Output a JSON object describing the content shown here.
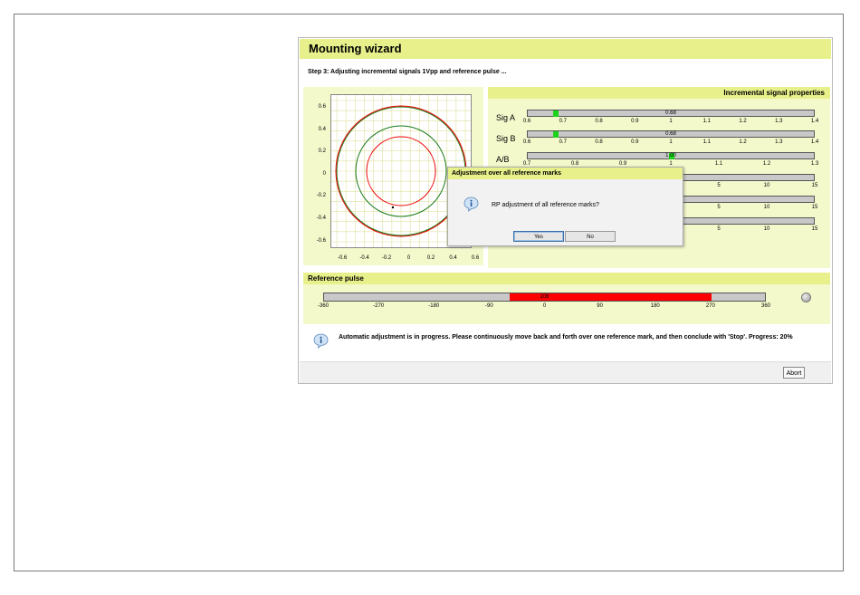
{
  "wizard": {
    "title": "Mounting wizard",
    "step": "Step 3: Adjusting incremental signals 1Vpp and reference pulse ...",
    "abort_label": "Abort",
    "message": "Automatic adjustment is in progress. Please continuously move back and forth over one reference mark, and then conclude with 'Stop'. Progress: 20%"
  },
  "plot": {
    "y_ticks": [
      "0.6",
      "0.4",
      "0.2",
      "0",
      "-0.2",
      "-0.4",
      "-0.6"
    ],
    "x_ticks": [
      "-0.6",
      "-0.4",
      "-0.2",
      "0",
      "0.2",
      "0.4",
      "0.6"
    ],
    "grid_color": "#e0e0a0"
  },
  "properties": {
    "title": "Incremental signal properties",
    "rows": [
      {
        "label": "Sig A",
        "value": "0.68",
        "fraction": 0.1,
        "ticks": [
          "0.6",
          "0.7",
          "0.8",
          "0.9",
          "1",
          "1.1",
          "1.2",
          "1.3",
          "1.4"
        ]
      },
      {
        "label": "Sig B",
        "value": "0.68",
        "fraction": 0.1,
        "ticks": [
          "0.6",
          "0.7",
          "0.8",
          "0.9",
          "1",
          "1.1",
          "1.2",
          "1.3",
          "1.4"
        ]
      },
      {
        "label": "A/B",
        "value": "1.00",
        "fraction": 0.5,
        "ticks": [
          "0.7",
          "0.8",
          "0.9",
          "1",
          "1.1",
          "1.2",
          "1.3"
        ]
      }
    ],
    "hidden_ticks": [
      "5",
      "10",
      "15"
    ]
  },
  "reference": {
    "title": "Reference pulse",
    "value": "108",
    "ticks": [
      "-360",
      "-270",
      "-180",
      "-90",
      "0",
      "90",
      "180",
      "270",
      "360"
    ]
  },
  "dialog": {
    "title": "Adjustment over all reference marks",
    "text": "RP adjustment of all reference marks?",
    "yes_label": "Yes",
    "no_label": "No"
  },
  "colors": {
    "accent": "#e7f08b",
    "panel": "#f4f9cc",
    "indicator": "#1bd31b",
    "rp_fill": "#ff0000"
  }
}
